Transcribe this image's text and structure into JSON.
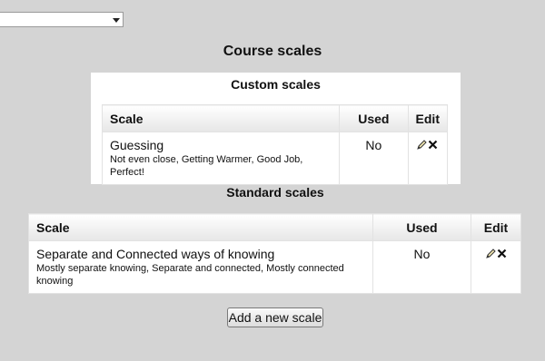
{
  "top_select": {
    "value": ""
  },
  "page": {
    "title": "Course scales"
  },
  "custom": {
    "title": "Custom scales",
    "columns": {
      "scale": "Scale",
      "used": "Used",
      "edit": "Edit"
    },
    "rows": [
      {
        "name": "Guessing",
        "items": "Not even close, Getting Warmer, Good Job, Perfect!",
        "used": "No"
      }
    ]
  },
  "standard": {
    "title": "Standard scales",
    "columns": {
      "scale": "Scale",
      "used": "Used",
      "edit": "Edit"
    },
    "rows": [
      {
        "name": "Separate and Connected ways of knowing",
        "items": "Mostly separate knowing, Separate and connected, Mostly connected knowing",
        "used": "No"
      }
    ]
  },
  "actions": {
    "add_scale": "Add a new scale"
  },
  "icons": {
    "edit": "edit-pencil-icon",
    "delete": "delete-x-icon"
  }
}
